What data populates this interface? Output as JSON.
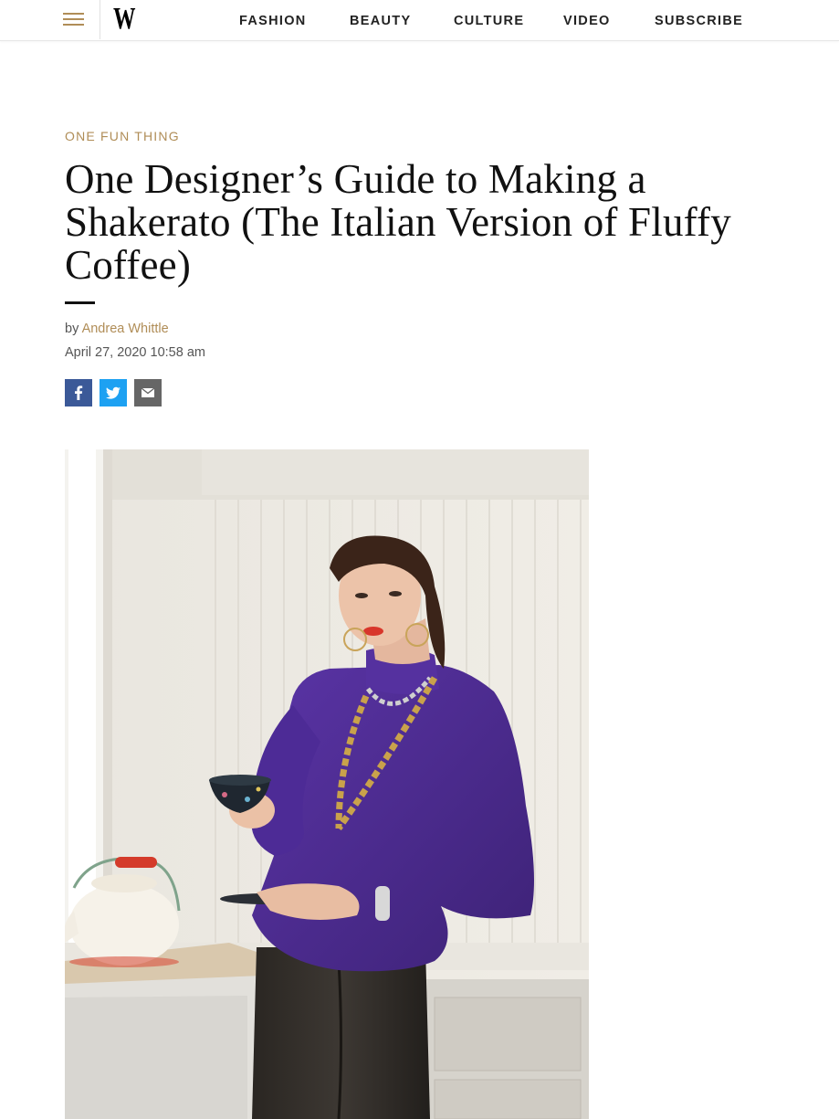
{
  "nav": {
    "menu_icon": "hamburger-menu-icon",
    "logo": "W",
    "links": [
      {
        "label": "FASHION"
      },
      {
        "label": "BEAUTY"
      },
      {
        "label": "CULTURE"
      },
      {
        "label": "VIDEO"
      },
      {
        "label": "SUBSCRIBE"
      }
    ]
  },
  "article": {
    "kicker": "ONE FUN THING",
    "headline": "One Designer’s Guide to Making a Shakerato (The Italian Version of Fluffy Coffee)",
    "byline_prefix": "by",
    "author": "Andrea Whittle",
    "date": "April 27, 2020 10:58 am"
  },
  "share": [
    {
      "icon": "facebook-icon",
      "color": "#3b5998"
    },
    {
      "icon": "twitter-icon",
      "color": "#1da1f2"
    },
    {
      "icon": "email-icon",
      "color": "#666666"
    }
  ],
  "colors": {
    "accent": "#b08d57",
    "sweater": "#4a2a8c"
  }
}
